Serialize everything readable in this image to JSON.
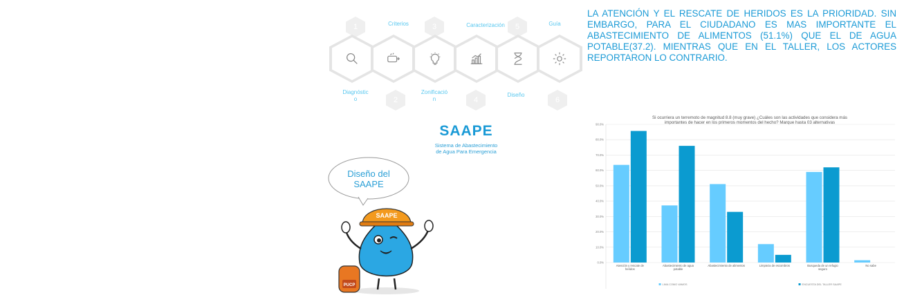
{
  "steps": {
    "numbers": [
      "1",
      "2",
      "3",
      "4",
      "5",
      "6"
    ],
    "labels_top": [
      "Criterios",
      "Caracterización",
      "Guía"
    ],
    "labels_bottom": [
      "Diagnóstic\no",
      "Zonificació\nn",
      "Diseño"
    ],
    "icon_names": [
      "magnifier-icon",
      "route-icon",
      "lightbulb-icon",
      "bar-growth-icon",
      "hourglass-icon",
      "gear-icon"
    ]
  },
  "logo": {
    "title": "SAAPE",
    "subtitle_line1": "Sistema de Abastecimiento",
    "subtitle_line2": "de Agua Para Emergencia",
    "mascot_helmet": "SAAPE",
    "backpack": "PUCP"
  },
  "bubble": {
    "line1": "Diseño del",
    "line2": "SAAPE"
  },
  "paragraph": "LA ATENCIÓN Y EL RESCATE DE HERIDOS ES LA PRIORIDAD. SIN EMBARGO, PARA EL CIUDADANO ES MAS IMPORTANTE EL ABASTECIMIENTO DE ALIMENTOS (51.1%) QUE EL DE AGUA POTABLE(37.2). MIENTRAS QUE EN EL TALLER, LOS ACTORES REPORTARON LO CONTRARIO.",
  "colors": {
    "accent": "#1a9ad6",
    "series1": "#66ccff",
    "series2": "#0b9bd0",
    "light_text": "#57c7ef"
  },
  "chart_data": {
    "type": "bar",
    "title": "Si ocurriera un terremoto de magnitud 8.8 (muy grave) ¿Cuáles son las actividades que considera más importantes de hacer en los primeros momentos del hecho? Marque hasta 03 alternativas",
    "categories": [
      "Atención y rescate de heridos",
      "Abastecimiento de agua potable",
      "Abastecimiento de alimentos",
      "Limpieza de escombros",
      "Busqueda de un refugio seguro",
      "No sabe"
    ],
    "series": [
      {
        "name": "LIMA COMO VAMOS",
        "values": [
          63.6,
          37.2,
          51.1,
          12.0,
          59.0,
          1.5
        ],
        "color": "#66ccff"
      },
      {
        "name": "ENCUESTA DEL TALLER SAAPE",
        "values": [
          85.7,
          76.0,
          33.0,
          5.0,
          62.0,
          0
        ],
        "color": "#0b9bd0"
      }
    ],
    "ylim": [
      0,
      90
    ],
    "yticks": [
      "0.0%",
      "10.0%",
      "20.0%",
      "30.0%",
      "40.0%",
      "50.0%",
      "60.0%",
      "70.0%",
      "80.0%",
      "90.0%"
    ],
    "grid": true,
    "legend": "bottom"
  }
}
